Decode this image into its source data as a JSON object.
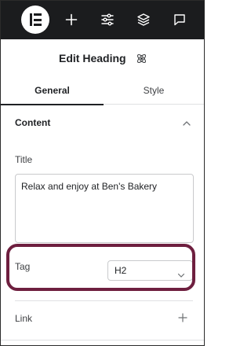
{
  "topbar": {
    "icons": [
      "elementor-logo-icon",
      "plus-icon",
      "sliders-icon",
      "layers-icon",
      "chat-icon"
    ]
  },
  "panel": {
    "title": "Edit Heading",
    "title_icon": "atom-icon"
  },
  "tabs": [
    {
      "label": "General",
      "active": true
    },
    {
      "label": "Style",
      "active": false
    }
  ],
  "content_section": {
    "title": "Content",
    "expanded": true
  },
  "fields": {
    "title_label": "Title",
    "title_value": "Relax and enjoy at Ben's Bakery",
    "tag_label": "Tag",
    "tag_value": "H2",
    "link_label": "Link"
  },
  "colors": {
    "topbar_bg": "#1b1c1e",
    "highlight_outline": "#6e1f3f",
    "text": "#1f2124"
  }
}
